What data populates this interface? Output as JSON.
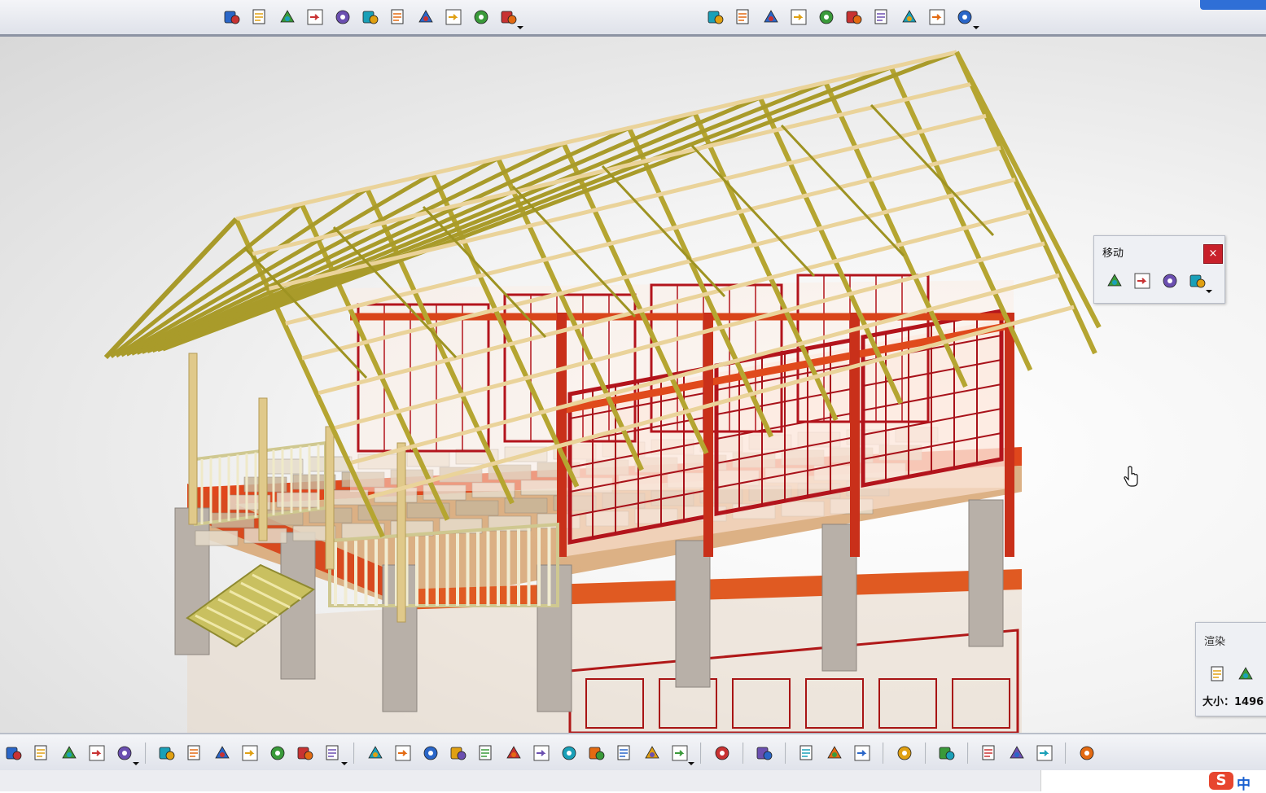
{
  "app": {
    "accent": "#2f6fd6",
    "viewport_background": "#f0f0f0"
  },
  "top_toolbar": {
    "group1": [
      "gear-multi-icon",
      "gear-doc-icon",
      "gear-settings-icon",
      "arrow-insert-icon",
      "arrow-edit-icon",
      "axis-tree-icon",
      "bom-list-icon",
      "annotation-a-icon",
      "tree-structure-icon",
      "table-list-icon",
      "gear-options-icon"
    ],
    "group2": [
      "link-pin-icon",
      "cube-blue-icon",
      "assembly-parts-icon",
      "pencil-box-icon",
      "anchor-icon",
      "pen-icon",
      "measure-table-icon",
      "snap-grid-icon",
      "refresh-arrows-icon",
      "sparkle-grid-icon"
    ]
  },
  "bottom_toolbar": {
    "groups": [
      [
        "copy-icon",
        "paste-icon",
        "undo-icon",
        "redo-icon",
        "whats-this-icon"
      ],
      [
        "formula-fx-icon",
        "comment-bubble-icon",
        "lightbulb-icon",
        "grid-table-icon",
        "node-tree-icon",
        "lock-icon",
        "split-icon"
      ],
      [
        "fly-icon",
        "fit-all-icon",
        "pan-icon",
        "rotate-icon",
        "zoom-in-icon",
        "zoom-out-icon",
        "normal-view-icon",
        "quick-view-icon",
        "iso-view-icon",
        "hide-show-icon",
        "shading-icon",
        "shading-edges-icon"
      ],
      [
        "print-icon"
      ],
      [
        "camera-icon"
      ],
      [
        "measure-between-icon",
        "measure-item-icon",
        "inertia-icon"
      ],
      [
        "update-icon"
      ],
      [
        "light-icon"
      ],
      [
        "apply-material-icon",
        "texture-icon",
        "colors-icon"
      ],
      [
        "grid-snap-icon"
      ]
    ]
  },
  "move_panel": {
    "title": "移动",
    "close_label": "×",
    "tools": [
      "manipulation-icon",
      "snap-move-icon",
      "smart-move-icon",
      "explode-icon"
    ]
  },
  "render_panel": {
    "title": "渲染",
    "tools": [
      "scene-editor-icon",
      "environment-icon"
    ],
    "size_label": "大小：1496"
  },
  "ime": {
    "logo": "S",
    "mode": "中"
  }
}
